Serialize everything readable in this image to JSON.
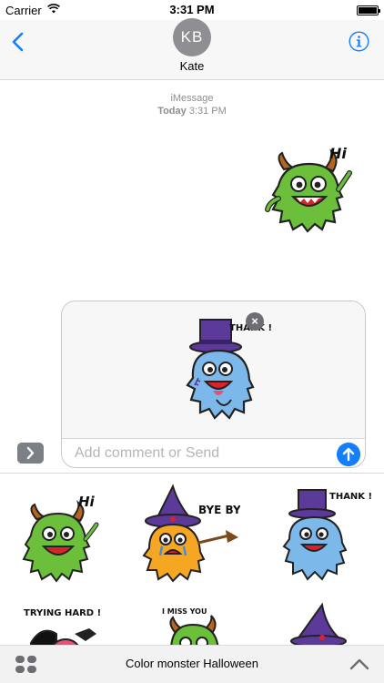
{
  "status_bar": {
    "carrier": "Carrier",
    "time": "3:31 PM"
  },
  "nav": {
    "avatar_initials": "KB",
    "contact_name": "Kate"
  },
  "conversation": {
    "service": "iMessage",
    "day": "Today",
    "time": "3:31 PM"
  },
  "sent_sticker": {
    "caption": "Hi"
  },
  "compose": {
    "preview_caption": "THANK !",
    "placeholder": "Add comment or Send"
  },
  "tray": {
    "stickers": [
      {
        "caption": "Hi"
      },
      {
        "caption": "BYE BYE"
      },
      {
        "caption": "THANK !"
      },
      {
        "caption": "TRYING HARD !"
      },
      {
        "caption": "I MISS YOU"
      },
      {
        "caption": ""
      }
    ]
  },
  "bottom_bar": {
    "app_name": "Color monster Halloween"
  },
  "colors": {
    "ios_blue": "#147efb",
    "green_monster": "#6cbf3a",
    "blue_monster": "#7db8ea",
    "orange_monster": "#f5a623",
    "purple_hat": "#5c3a99"
  }
}
